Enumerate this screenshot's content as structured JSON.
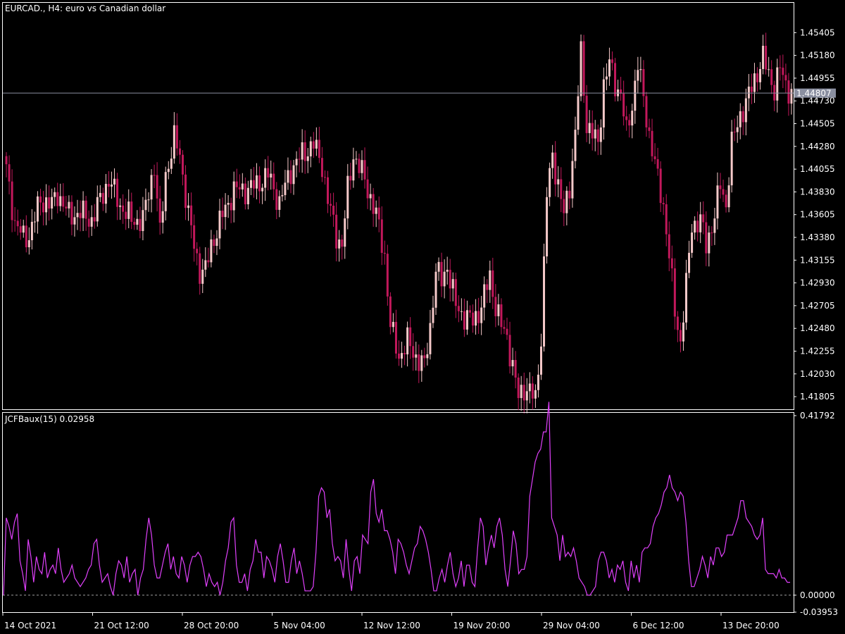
{
  "window": {
    "title": "EURCAD., H4:  euro vs Canadian dollar"
  },
  "colors": {
    "background": "#000000",
    "frame": "#ffffff",
    "bull_candle": "#f5c9c9",
    "bear_candle": "#c2185b",
    "indicator_line": "#e040fb",
    "bid_line": "#8a8fa0",
    "bid_label_bg": "#8a8fa0",
    "zero_line": "#9e9e9e"
  },
  "chart_data": [
    {
      "type": "candlestick",
      "title": "EURCAD., H4:  euro vs Canadian dollar",
      "symbol": "EURCAD.",
      "timeframe": "H4",
      "description": "euro vs Canadian dollar",
      "ylim": [
        1.4168,
        1.457
      ],
      "yticks": [
        "1.45405",
        "1.45180",
        "1.44955",
        "1.44730",
        "1.44505",
        "1.44280",
        "1.44055",
        "1.43830",
        "1.43605",
        "1.43380",
        "1.43155",
        "1.42930",
        "1.42705",
        "1.42480",
        "1.42255",
        "1.42030",
        "1.41805"
      ],
      "current_price": "1.44807",
      "current_price_value": 1.44807,
      "close_anchors": [
        [
          0,
          1.4405
        ],
        [
          3,
          1.4352
        ],
        [
          6,
          1.4338
        ],
        [
          8,
          1.434
        ],
        [
          12,
          1.4375
        ],
        [
          16,
          1.437
        ],
        [
          18,
          1.4382
        ],
        [
          22,
          1.436
        ],
        [
          26,
          1.4362
        ],
        [
          30,
          1.4355
        ],
        [
          36,
          1.4395
        ],
        [
          40,
          1.437
        ],
        [
          44,
          1.4355
        ],
        [
          48,
          1.4355
        ],
        [
          52,
          1.441
        ],
        [
          54,
          1.434
        ],
        [
          56,
          1.44
        ],
        [
          59,
          1.4435
        ],
        [
          61,
          1.442
        ],
        [
          64,
          1.436
        ],
        [
          66,
          1.433
        ],
        [
          68,
          1.4305
        ],
        [
          70,
          1.4305
        ],
        [
          72,
          1.433
        ],
        [
          76,
          1.436
        ],
        [
          80,
          1.4385
        ],
        [
          84,
          1.4385
        ],
        [
          88,
          1.439
        ],
        [
          92,
          1.44
        ],
        [
          96,
          1.4372
        ],
        [
          100,
          1.4405
        ],
        [
          104,
          1.442
        ],
        [
          108,
          1.443
        ],
        [
          111,
          1.441
        ],
        [
          113,
          1.4375
        ],
        [
          116,
          1.434
        ],
        [
          118,
          1.433
        ],
        [
          120,
          1.4385
        ],
        [
          122,
          1.442
        ],
        [
          126,
          1.4395
        ],
        [
          130,
          1.436
        ],
        [
          133,
          1.432
        ],
        [
          135,
          1.425
        ],
        [
          138,
          1.422
        ],
        [
          141,
          1.4235
        ],
        [
          144,
          1.422
        ],
        [
          147,
          1.421
        ],
        [
          149,
          1.425
        ],
        [
          151,
          1.4305
        ],
        [
          153,
          1.4295
        ],
        [
          155,
          1.431
        ],
        [
          158,
          1.427
        ],
        [
          161,
          1.426
        ],
        [
          164,
          1.4255
        ],
        [
          167,
          1.427
        ],
        [
          170,
          1.43
        ],
        [
          172,
          1.427
        ],
        [
          174,
          1.425
        ],
        [
          176,
          1.424
        ],
        [
          178,
          1.421
        ],
        [
          180,
          1.418
        ],
        [
          182,
          1.419
        ],
        [
          184,
          1.4185
        ],
        [
          186,
          1.4178
        ],
        [
          188,
          1.424
        ],
        [
          190,
          1.438
        ],
        [
          192,
          1.442
        ],
        [
          194,
          1.439
        ],
        [
          196,
          1.436
        ],
        [
          198,
          1.439
        ],
        [
          200,
          1.444
        ],
        [
          202,
          1.452
        ],
        [
          204,
          1.445
        ],
        [
          206,
          1.444
        ],
        [
          208,
          1.443
        ],
        [
          210,
          1.449
        ],
        [
          212,
          1.451
        ],
        [
          214,
          1.449
        ],
        [
          216,
          1.448
        ],
        [
          218,
          1.444
        ],
        [
          220,
          1.447
        ],
        [
          222,
          1.451
        ],
        [
          224,
          1.4475
        ],
        [
          226,
          1.444
        ],
        [
          229,
          1.4395
        ],
        [
          231,
          1.437
        ],
        [
          233,
          1.432
        ],
        [
          235,
          1.4265
        ],
        [
          237,
          1.4235
        ],
        [
          239,
          1.429
        ],
        [
          241,
          1.435
        ],
        [
          244,
          1.4355
        ],
        [
          246,
          1.433
        ],
        [
          249,
          1.436
        ],
        [
          251,
          1.439
        ],
        [
          253,
          1.437
        ],
        [
          255,
          1.443
        ],
        [
          258,
          1.446
        ],
        [
          260,
          1.447
        ],
        [
          263,
          1.4495
        ],
        [
          266,
          1.4515
        ],
        [
          268,
          1.45
        ],
        [
          270,
          1.4485
        ],
        [
          272,
          1.4505
        ],
        [
          274,
          1.449
        ],
        [
          276,
          1.448
        ]
      ]
    },
    {
      "type": "line",
      "title": "JCFBaux(15) 0.02958",
      "indicator_name": "JCFBaux(15)",
      "indicator_value": "0.02958",
      "ylim": [
        -0.03953,
        0.41792
      ],
      "yticks": [
        "0.41792",
        "0.00000",
        "-0.03953"
      ],
      "reference_level": 0.0,
      "values": [
        0.0,
        0.18,
        0.16,
        0.13,
        0.17,
        0.19,
        0.08,
        0.05,
        0.01,
        0.13,
        0.09,
        0.03,
        0.09,
        0.06,
        0.05,
        0.1,
        0.04,
        0.06,
        0.07,
        0.05,
        0.11,
        0.06,
        0.03,
        0.04,
        0.05,
        0.07,
        0.04,
        0.03,
        0.02,
        0.03,
        0.04,
        0.06,
        0.07,
        0.12,
        0.13,
        0.07,
        0.03,
        0.04,
        0.05,
        0.02,
        0.0,
        0.05,
        0.08,
        0.07,
        0.04,
        0.09,
        0.03,
        0.05,
        0.06,
        0.0,
        0.04,
        0.06,
        0.13,
        0.18,
        0.14,
        0.07,
        0.04,
        0.04,
        0.07,
        0.1,
        0.12,
        0.06,
        0.09,
        0.05,
        0.04,
        0.09,
        0.07,
        0.03,
        0.07,
        0.09,
        0.09,
        0.1,
        0.09,
        0.06,
        0.02,
        0.05,
        0.03,
        0.02,
        0.03,
        0.0,
        0.03,
        0.08,
        0.11,
        0.17,
        0.18,
        0.07,
        0.03,
        0.03,
        0.05,
        0.01,
        0.06,
        0.08,
        0.13,
        0.1,
        0.1,
        0.04,
        0.09,
        0.08,
        0.06,
        0.03,
        0.09,
        0.12,
        0.08,
        0.03,
        0.03,
        0.08,
        0.11,
        0.05,
        0.08,
        0.05,
        0.01,
        0.01,
        0.01,
        0.02,
        0.1,
        0.23,
        0.25,
        0.24,
        0.18,
        0.2,
        0.12,
        0.08,
        0.09,
        0.08,
        0.04,
        0.13,
        0.06,
        0.01,
        0.08,
        0.09,
        0.05,
        0.14,
        0.13,
        0.12,
        0.24,
        0.27,
        0.19,
        0.17,
        0.2,
        0.15,
        0.15,
        0.13,
        0.1,
        0.05,
        0.13,
        0.12,
        0.1,
        0.07,
        0.05,
        0.08,
        0.11,
        0.12,
        0.16,
        0.15,
        0.13,
        0.1,
        0.06,
        0.01,
        0.01,
        0.04,
        0.06,
        0.03,
        0.07,
        0.1,
        0.05,
        0.02,
        0.04,
        0.08,
        0.02,
        0.07,
        0.07,
        0.03,
        0.02,
        0.11,
        0.18,
        0.16,
        0.07,
        0.11,
        0.14,
        0.11,
        0.16,
        0.18,
        0.14,
        0.06,
        0.02,
        0.08,
        0.15,
        0.12,
        0.05,
        0.06,
        0.06,
        0.09,
        0.23,
        0.27,
        0.31,
        0.33,
        0.34,
        0.38,
        0.38,
        0.45,
        0.18,
        0.16,
        0.14,
        0.08,
        0.14,
        0.09,
        0.1,
        0.09,
        0.11,
        0.08,
        0.04,
        0.03,
        0.02,
        0.0,
        0.0,
        0.01,
        0.02,
        0.08,
        0.1,
        0.1,
        0.08,
        0.04,
        0.06,
        0.03,
        0.07,
        0.06,
        0.08,
        0.03,
        0.01,
        0.08,
        0.04,
        0.07,
        0.03,
        0.1,
        0.11,
        0.11,
        0.12,
        0.16,
        0.18,
        0.19,
        0.21,
        0.24,
        0.25,
        0.28,
        0.25,
        0.24,
        0.22,
        0.24,
        0.23,
        0.17,
        0.08,
        0.02,
        0.02,
        0.04,
        0.06,
        0.09,
        0.07,
        0.04,
        0.09,
        0.07,
        0.11,
        0.11,
        0.09,
        0.1,
        0.14,
        0.14,
        0.14,
        0.16,
        0.18,
        0.22,
        0.22,
        0.18,
        0.17,
        0.16,
        0.14,
        0.13,
        0.14,
        0.18,
        0.06,
        0.05,
        0.05,
        0.05,
        0.04,
        0.06,
        0.04,
        0.04,
        0.03,
        0.03
      ]
    }
  ],
  "time_axis": {
    "labels": [
      "14 Oct 2021",
      "21 Oct 12:00",
      "28 Oct 20:00",
      "5 Nov 04:00",
      "12 Nov 12:00",
      "19 Nov 20:00",
      "29 Nov 04:00",
      "6 Dec 12:00",
      "13 Dec 20:00"
    ]
  }
}
